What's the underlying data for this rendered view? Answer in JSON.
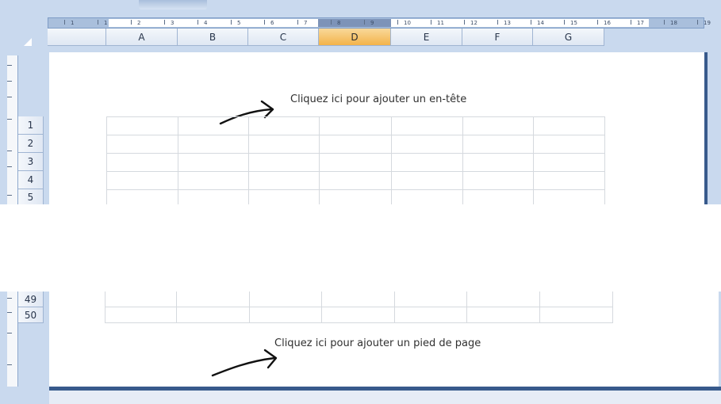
{
  "columns": [
    {
      "id": "A",
      "label": "A",
      "selected": false
    },
    {
      "id": "B",
      "label": "B",
      "selected": false
    },
    {
      "id": "C",
      "label": "C",
      "selected": false
    },
    {
      "id": "D",
      "label": "D",
      "selected": true
    },
    {
      "id": "E",
      "label": "E",
      "selected": false
    },
    {
      "id": "F",
      "label": "F",
      "selected": false
    },
    {
      "id": "G",
      "label": "G",
      "selected": false
    }
  ],
  "top_rows": [
    "1",
    "2",
    "3",
    "4",
    "5"
  ],
  "bottom_rows": [
    "49",
    "50"
  ],
  "ruler_numbers": [
    "1",
    "1",
    "2",
    "3",
    "4",
    "5",
    "6",
    "7",
    "8",
    "9",
    "10",
    "11",
    "12",
    "13",
    "14",
    "15",
    "16",
    "17",
    "18",
    "19"
  ],
  "vertical_ruler_labels": [
    "1",
    "2",
    "3",
    "4"
  ],
  "header_hint": "Cliquez ici pour ajouter un en-tête",
  "footer_hint": "Cliquez ici pour ajouter un pied de page",
  "colors": {
    "selected_header": "#f3b34a",
    "frame_blue": "#c9d9ee",
    "page_shadow": "#385a8c"
  },
  "icons": {
    "select_all": "triangle-icon",
    "annotation": "hand-drawn-arrow-icon"
  }
}
